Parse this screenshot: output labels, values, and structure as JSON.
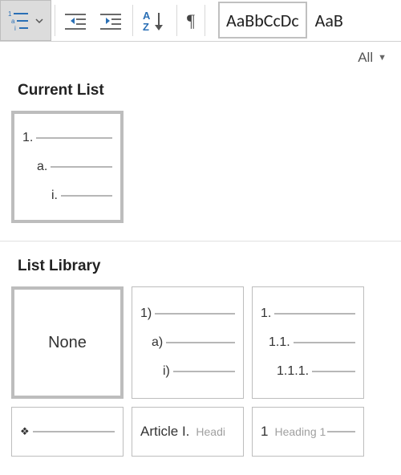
{
  "ribbon": {
    "styles_preview_1": "AaBbCcDc",
    "styles_preview_2": "AaB"
  },
  "gallery": {
    "filter_label": "All",
    "section_current": "Current List",
    "section_library": "List Library",
    "current": {
      "l1": "1.",
      "l2": "a.",
      "l3": "i."
    },
    "library": [
      {
        "kind": "none",
        "label": "None"
      },
      {
        "kind": "three",
        "l1": "1)",
        "l2": "a)",
        "l3": "i)"
      },
      {
        "kind": "three",
        "l1": "1.",
        "l2": "1.1.",
        "l3": "1.1.1."
      },
      {
        "kind": "single",
        "prefix_icon": "diamond"
      },
      {
        "kind": "article",
        "text_a": "Article I.",
        "text_b": "Headi"
      },
      {
        "kind": "heading",
        "text_a": "1",
        "text_b": "Heading 1"
      }
    ]
  }
}
